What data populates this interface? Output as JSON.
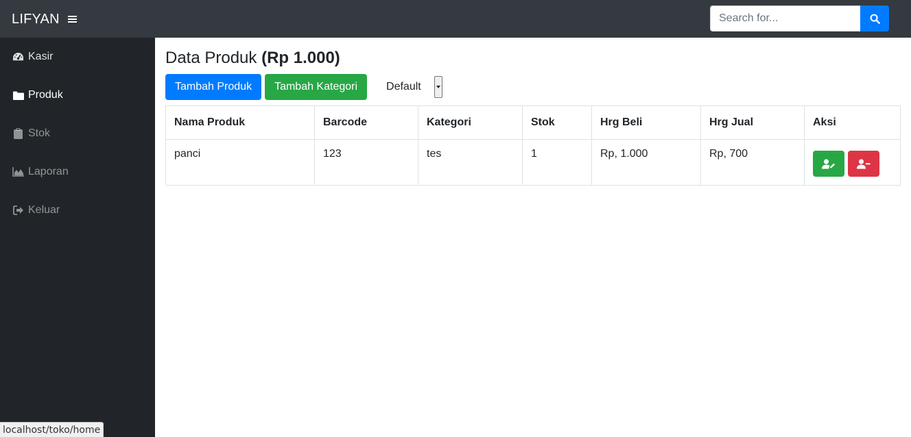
{
  "navbar": {
    "brand": "LIFYAN",
    "search": {
      "placeholder": "Search for...",
      "value": ""
    }
  },
  "sidebar": {
    "items": [
      {
        "label": "Kasir",
        "icon": "tachometer-icon"
      },
      {
        "label": "Produk",
        "icon": "folder-icon"
      },
      {
        "label": "Stok",
        "icon": "clipboard-icon"
      },
      {
        "label": "Laporan",
        "icon": "area-chart-icon"
      },
      {
        "label": "Keluar",
        "icon": "sign-out-icon"
      }
    ]
  },
  "page": {
    "title": "Data Produk",
    "title_total": "(Rp 1.000)"
  },
  "toolbar": {
    "add_product_label": "Tambah Produk",
    "add_category_label": "Tambah Kategori",
    "filter_selected": "Default"
  },
  "table": {
    "headers": [
      "Nama Produk",
      "Barcode",
      "Kategori",
      "Stok",
      "Hrg Beli",
      "Hrg Jual",
      "Aksi"
    ],
    "rows": [
      {
        "nama": "panci",
        "barcode": "123",
        "kategori": "tes",
        "stok": "1",
        "hrg_beli": "Rp, 1.000",
        "hrg_jual": "Rp, 700"
      }
    ]
  },
  "statusbar": {
    "url": "localhost/toko/home"
  },
  "colors": {
    "navbar_bg": "#343a40",
    "sidebar_bg": "#212529",
    "primary": "#007bff",
    "success": "#28a745",
    "danger": "#dc3545"
  }
}
